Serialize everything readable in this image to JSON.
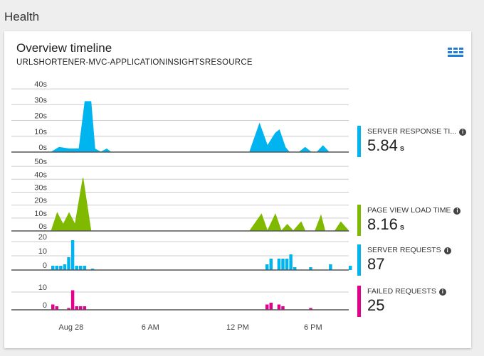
{
  "header": {
    "section_title": "Health"
  },
  "card": {
    "title": "Overview timeline",
    "subtitle": "URLSHORTENER-MVC-APPLICATIONINSIGHTSRESOURCE",
    "grid_icon": "grid-icon"
  },
  "colors": {
    "blue": "#00b4f0",
    "green": "#7fba00",
    "pink": "#e3008c",
    "axis": "#555555",
    "grid": "#cccccc"
  },
  "metrics": [
    {
      "label": "SERVER RESPONSE TI...",
      "value": "5.84",
      "unit": "s",
      "color": "#00b4f0"
    },
    {
      "label": "PAGE VIEW LOAD TIME",
      "value": "8.16",
      "unit": "s",
      "color": "#7fba00"
    },
    {
      "label": "SERVER REQUESTS",
      "value": "87",
      "unit": "",
      "color": "#00b4f0"
    },
    {
      "label": "FAILED REQUESTS",
      "value": "25",
      "unit": "",
      "color": "#e3008c"
    }
  ],
  "chart_data": [
    {
      "type": "area",
      "ylabels": [
        "40s",
        "30s",
        "20s",
        "10s",
        "0s"
      ],
      "yticks": [
        40,
        30,
        20,
        10,
        0
      ],
      "ylim": [
        0,
        45
      ],
      "color": "#00b4f0",
      "points": [
        [
          0,
          0
        ],
        [
          4,
          3
        ],
        [
          9,
          2
        ],
        [
          14,
          2
        ],
        [
          17,
          32
        ],
        [
          20,
          32
        ],
        [
          22,
          2
        ],
        [
          25,
          0
        ],
        [
          28,
          2
        ],
        [
          30,
          0
        ],
        [
          100,
          0
        ],
        [
          105,
          18
        ],
        [
          109,
          4
        ],
        [
          113,
          12
        ],
        [
          115,
          14
        ],
        [
          118,
          3
        ],
        [
          120,
          0
        ],
        [
          125,
          0
        ],
        [
          128,
          3
        ],
        [
          131,
          0
        ],
        [
          134,
          0
        ],
        [
          137,
          4
        ],
        [
          140,
          0
        ],
        [
          145,
          0
        ],
        [
          149,
          0
        ],
        [
          150,
          0
        ]
      ]
    },
    {
      "type": "area",
      "ylabels": [
        "50s",
        "40s",
        "30s",
        "20s",
        "10s",
        "0s"
      ],
      "yticks": [
        50,
        40,
        30,
        20,
        10,
        0
      ],
      "ylim": [
        0,
        55
      ],
      "color": "#7fba00",
      "points": [
        [
          0,
          0
        ],
        [
          3,
          14
        ],
        [
          6,
          5
        ],
        [
          9,
          14
        ],
        [
          12,
          5
        ],
        [
          16,
          41
        ],
        [
          20,
          0
        ],
        [
          100,
          0
        ],
        [
          106,
          13
        ],
        [
          109,
          0
        ],
        [
          113,
          13
        ],
        [
          116,
          0
        ],
        [
          119,
          5
        ],
        [
          122,
          0
        ],
        [
          126,
          7
        ],
        [
          128,
          0
        ],
        [
          133,
          0
        ],
        [
          136,
          12
        ],
        [
          138,
          0
        ],
        [
          143,
          0
        ],
        [
          146,
          7
        ],
        [
          150,
          0
        ]
      ]
    },
    {
      "type": "bar",
      "ylabels": [
        "20",
        "10",
        "0"
      ],
      "yticks": [
        20,
        10,
        0
      ],
      "ylim": [
        0,
        22
      ],
      "color": "#00b4f0",
      "bars": [
        [
          0,
          3
        ],
        [
          2,
          3
        ],
        [
          4,
          3
        ],
        [
          6,
          4
        ],
        [
          8,
          9
        ],
        [
          10,
          21
        ],
        [
          12,
          3
        ],
        [
          14,
          3
        ],
        [
          16,
          3
        ],
        [
          20,
          1
        ],
        [
          108,
          4
        ],
        [
          110,
          8
        ],
        [
          114,
          8
        ],
        [
          116,
          8
        ],
        [
          118,
          8
        ],
        [
          120,
          11
        ],
        [
          122,
          2
        ],
        [
          130,
          2
        ],
        [
          140,
          4
        ],
        [
          150,
          3
        ]
      ]
    },
    {
      "type": "bar",
      "ylabels": [
        "10",
        "0"
      ],
      "yticks": [
        10,
        0
      ],
      "ylim": [
        0,
        16
      ],
      "color": "#e3008c",
      "bars": [
        [
          0,
          3
        ],
        [
          2,
          2
        ],
        [
          8,
          1
        ],
        [
          10,
          11
        ],
        [
          12,
          2
        ],
        [
          14,
          2
        ],
        [
          16,
          2
        ],
        [
          108,
          3
        ],
        [
          110,
          4
        ],
        [
          114,
          3
        ],
        [
          116,
          2
        ],
        [
          130,
          1
        ]
      ]
    }
  ],
  "xaxis": {
    "ticks": [
      {
        "label": "Aug 28",
        "x": 10
      },
      {
        "label": "6 AM",
        "x": 50
      },
      {
        "label": "12 PM",
        "x": 94
      },
      {
        "label": "6 PM",
        "x": 132
      }
    ],
    "xlim": [
      0,
      150
    ]
  }
}
